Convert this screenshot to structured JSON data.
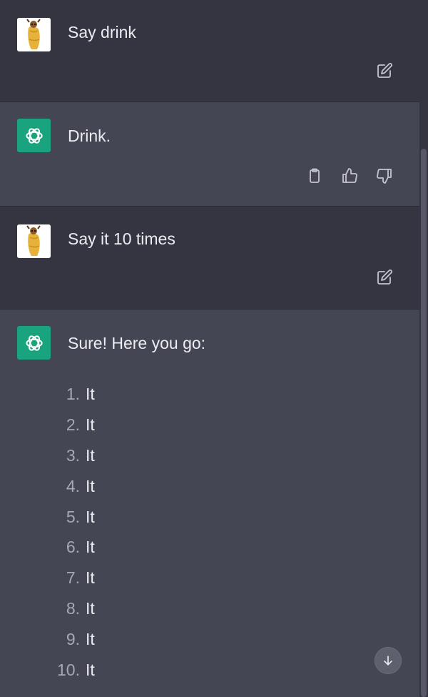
{
  "conversation": {
    "messages": [
      {
        "role": "user",
        "text": "Say drink",
        "action_icons": [
          "edit-icon"
        ]
      },
      {
        "role": "assistant",
        "text": "Drink.",
        "action_icons": [
          "clipboard-icon",
          "thumbs-up-icon",
          "thumbs-down-icon"
        ]
      },
      {
        "role": "user",
        "text": "Say it 10 times",
        "action_icons": [
          "edit-icon"
        ]
      },
      {
        "role": "assistant",
        "text": "Sure! Here you go:",
        "list": [
          {
            "number": "1.",
            "text": "It"
          },
          {
            "number": "2.",
            "text": "It"
          },
          {
            "number": "3.",
            "text": "It"
          },
          {
            "number": "4.",
            "text": "It"
          },
          {
            "number": "5.",
            "text": "It"
          },
          {
            "number": "6.",
            "text": "It"
          },
          {
            "number": "7.",
            "text": "It"
          },
          {
            "number": "8.",
            "text": "It"
          },
          {
            "number": "9.",
            "text": "It"
          },
          {
            "number": "10.",
            "text": "It"
          }
        ]
      }
    ]
  },
  "controls": {
    "scroll_down_icon": "arrow-down-icon"
  },
  "colors": {
    "user_bg": "#343541",
    "assistant_bg": "#444654",
    "gpt_avatar": "#19a37f",
    "text": "#ececf1",
    "icon": "#c5c5d2"
  }
}
